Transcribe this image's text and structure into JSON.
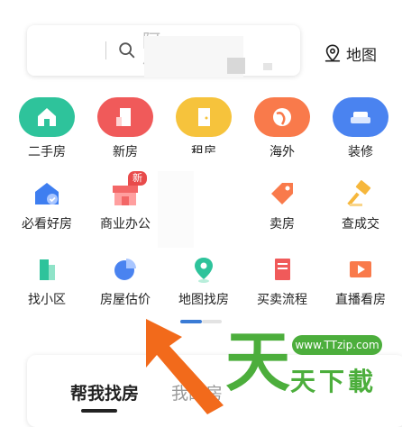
{
  "search": {
    "placeholder_partial": "阿\n小"
  },
  "map_entry": {
    "label": "地图"
  },
  "grid": {
    "row1": [
      {
        "label": "二手房",
        "icon": "house-icon",
        "color": "#2ec39b"
      },
      {
        "label": "新房",
        "icon": "building-icon",
        "color": "#f05a5a"
      },
      {
        "label": "租房",
        "icon": "door-icon",
        "color": "#f6c33c"
      },
      {
        "label": "海外",
        "icon": "globe-icon",
        "color": "#f97a4b"
      },
      {
        "label": "装修",
        "icon": "sofa-icon",
        "color": "#4a83f0"
      }
    ],
    "row2": [
      {
        "label": "必看好房",
        "icon": "heart-house-icon",
        "color": "#3e7ef0"
      },
      {
        "label": "商业办公",
        "icon": "store-icon",
        "color": "#f36767",
        "badge": "新"
      },
      {
        "label": "",
        "icon": "",
        "color": ""
      },
      {
        "label": "卖房",
        "icon": "tag-icon",
        "color": "#f97a4b"
      },
      {
        "label": "查成交",
        "icon": "hammer-icon",
        "color": "#f6b73c"
      }
    ],
    "row3": [
      {
        "label": "找小区",
        "icon": "tower-icon",
        "color": "#2ec39b"
      },
      {
        "label": "房屋估价",
        "icon": "piechart-icon",
        "color": "#4a83f0"
      },
      {
        "label": "地图找房",
        "icon": "pin-icon",
        "color": "#2ec39b"
      },
      {
        "label": "买卖流程",
        "icon": "book-icon",
        "color": "#f05a5a"
      },
      {
        "label": "直播看房",
        "icon": "video-icon",
        "color": "#f97a4b"
      }
    ]
  },
  "bottom": {
    "tab_active": "帮我找房",
    "tab_inactive": "我的房"
  },
  "watermark": {
    "url": "www.TTzip.com",
    "big": "天",
    "sub": "天下載"
  }
}
